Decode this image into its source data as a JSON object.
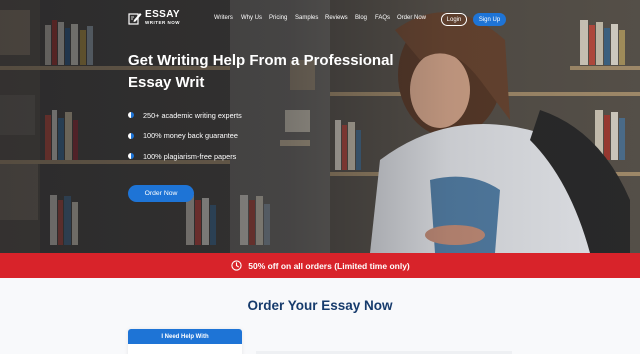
{
  "brand": {
    "name": "ESSAY",
    "tagline": "WRITER NOW"
  },
  "nav": {
    "items": [
      {
        "label": "Writers"
      },
      {
        "label": "Why Us"
      },
      {
        "label": "Pricing"
      },
      {
        "label": "Samples"
      },
      {
        "label": "Reviews"
      },
      {
        "label": "Blog"
      },
      {
        "label": "FAQs"
      },
      {
        "label": "Order Now"
      }
    ],
    "login_label": "Login",
    "signup_label": "Sign Up"
  },
  "hero": {
    "title": "Get Writing Help From a Professional Essay Writ",
    "features": [
      {
        "text": "250+ academic writing experts"
      },
      {
        "text": "100% money back guarantee"
      },
      {
        "text": "100% plagiarism-free papers"
      }
    ],
    "cta_label": "Order Now"
  },
  "promo": {
    "text": "50% off on all orders (Limited time only)",
    "icon": "clock-icon"
  },
  "order": {
    "title": "Order Your Essay Now",
    "help_card_title": "I Need Help With"
  },
  "colors": {
    "accent": "#1e74d6",
    "promo": "#d8232a",
    "heading": "#163b6c"
  }
}
